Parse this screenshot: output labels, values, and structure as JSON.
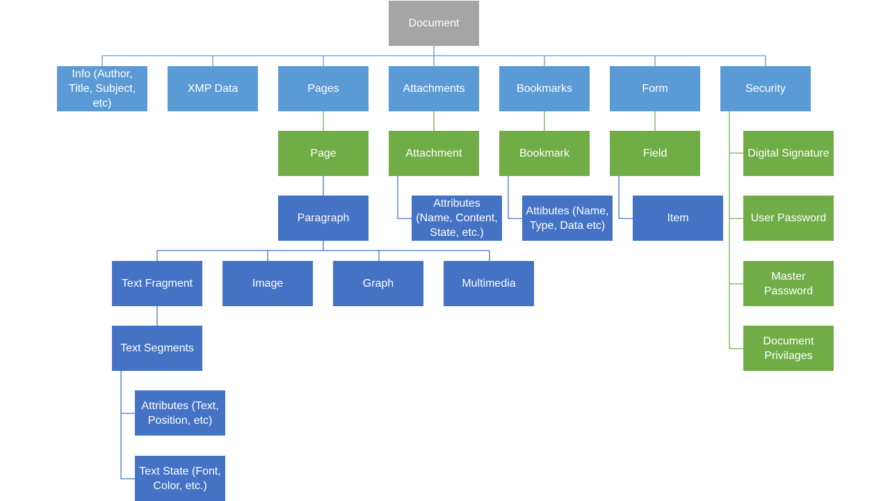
{
  "diagram": {
    "root": "Document",
    "colors": {
      "root": "#a5a5a5",
      "level1": "#5b9bd5",
      "collection_item": "#70ad47",
      "content": "#4472c4",
      "connector_blue": "#5b9bd5",
      "connector_dark": "#4472c4",
      "connector_green": "#70ad47"
    },
    "nodes": {
      "document": "Document",
      "info": "Info (Author,\nTitle, Subject,\netc)",
      "xmp": "XMP Data",
      "pages": "Pages",
      "attachments": "Attachments",
      "bookmarks": "Bookmarks",
      "form": "Form",
      "security": "Security",
      "page": "Page",
      "attachment": "Attachment",
      "bookmark": "Bookmark",
      "field": "Field",
      "paragraph": "Paragraph",
      "attachment_attributes": "Attributes\n(Name, Content,\nState, etc.)",
      "bookmark_attributes": "Attibutes (Name,\nType, Data etc)",
      "item": "Item",
      "text_fragment": "Text Fragment",
      "image": "Image",
      "graph": "Graph",
      "multimedia": "Multimedia",
      "text_segments": "Text Segments",
      "segment_attributes": "Attributes (Text,\nPosition, etc)",
      "text_state": "Text State (Font,\nColor, etc.)",
      "digital_signature": "Digital Signature",
      "user_password": "User Password",
      "master_password": "Master\nPassword",
      "document_privilages": "Document\nPrivilages"
    },
    "edges": [
      [
        "document",
        "info"
      ],
      [
        "document",
        "xmp"
      ],
      [
        "document",
        "pages"
      ],
      [
        "document",
        "attachments"
      ],
      [
        "document",
        "bookmarks"
      ],
      [
        "document",
        "form"
      ],
      [
        "document",
        "security"
      ],
      [
        "pages",
        "page"
      ],
      [
        "attachments",
        "attachment"
      ],
      [
        "bookmarks",
        "bookmark"
      ],
      [
        "form",
        "field"
      ],
      [
        "page",
        "paragraph"
      ],
      [
        "attachment",
        "attachment_attributes"
      ],
      [
        "bookmark",
        "bookmark_attributes"
      ],
      [
        "field",
        "item"
      ],
      [
        "paragraph",
        "text_fragment"
      ],
      [
        "paragraph",
        "image"
      ],
      [
        "paragraph",
        "graph"
      ],
      [
        "paragraph",
        "multimedia"
      ],
      [
        "text_fragment",
        "text_segments"
      ],
      [
        "text_segments",
        "segment_attributes"
      ],
      [
        "text_segments",
        "text_state"
      ],
      [
        "security",
        "digital_signature"
      ],
      [
        "security",
        "user_password"
      ],
      [
        "security",
        "master_password"
      ],
      [
        "security",
        "document_privilages"
      ]
    ]
  }
}
